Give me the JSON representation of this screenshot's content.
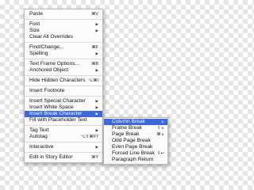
{
  "menu": {
    "groups": [
      [
        {
          "label": "Paste",
          "shortcut": "⌘V",
          "arrow": ""
        }
      ],
      [
        {
          "label": "Font",
          "shortcut": "",
          "arrow": "▶"
        },
        {
          "label": "Size",
          "shortcut": "",
          "arrow": "▶"
        },
        {
          "label": "Clear All Overrides",
          "shortcut": "",
          "arrow": ""
        }
      ],
      [
        {
          "label": "Find/Change...",
          "shortcut": "⌘F",
          "arrow": ""
        },
        {
          "label": "Spelling",
          "shortcut": "",
          "arrow": "▶"
        }
      ],
      [
        {
          "label": "Text Frame Options...",
          "shortcut": "⌘B",
          "arrow": ""
        },
        {
          "label": "Anchored Object",
          "shortcut": "",
          "arrow": "▶"
        }
      ],
      [
        {
          "label": "Hide Hidden Characters",
          "shortcut": "⌥⌘I",
          "arrow": ""
        }
      ],
      [
        {
          "label": "Insert Footnote",
          "shortcut": "",
          "arrow": ""
        }
      ],
      [
        {
          "label": "Insert Special Character",
          "shortcut": "",
          "arrow": "▶"
        },
        {
          "label": "Insert White Space",
          "shortcut": "",
          "arrow": "▶"
        },
        {
          "label": "Insert Break Character",
          "shortcut": "",
          "arrow": "▶",
          "highlighted": true
        },
        {
          "label": "Fill with Placeholder Text",
          "shortcut": "",
          "arrow": ""
        }
      ],
      [
        {
          "label": "Tag Text",
          "shortcut": "",
          "arrow": "▶"
        },
        {
          "label": "Autotag",
          "shortcut": "⌥⇧⌘F7",
          "arrow": ""
        }
      ],
      [
        {
          "label": "Interactive",
          "shortcut": "",
          "arrow": "▶"
        }
      ],
      [
        {
          "label": "Edit in Story Editor",
          "shortcut": "⌘Y",
          "arrow": ""
        }
      ]
    ]
  },
  "submenu": {
    "items": [
      {
        "label": "Column Break",
        "shortcut": "⌅",
        "highlighted": true
      },
      {
        "label": "Frame Break",
        "shortcut": "⇧⌅"
      },
      {
        "label": "Page Break",
        "shortcut": "⌘⌅"
      },
      {
        "label": "Odd Page Break",
        "shortcut": ""
      },
      {
        "label": "Even Page Break",
        "shortcut": ""
      },
      {
        "label": "Forced Line Break",
        "shortcut": "⇧↩"
      },
      {
        "label": "Paragraph Return",
        "shortcut": ""
      }
    ]
  },
  "colors": {
    "highlight": "#3c68d8",
    "menu_background": "#fbfbfb"
  }
}
